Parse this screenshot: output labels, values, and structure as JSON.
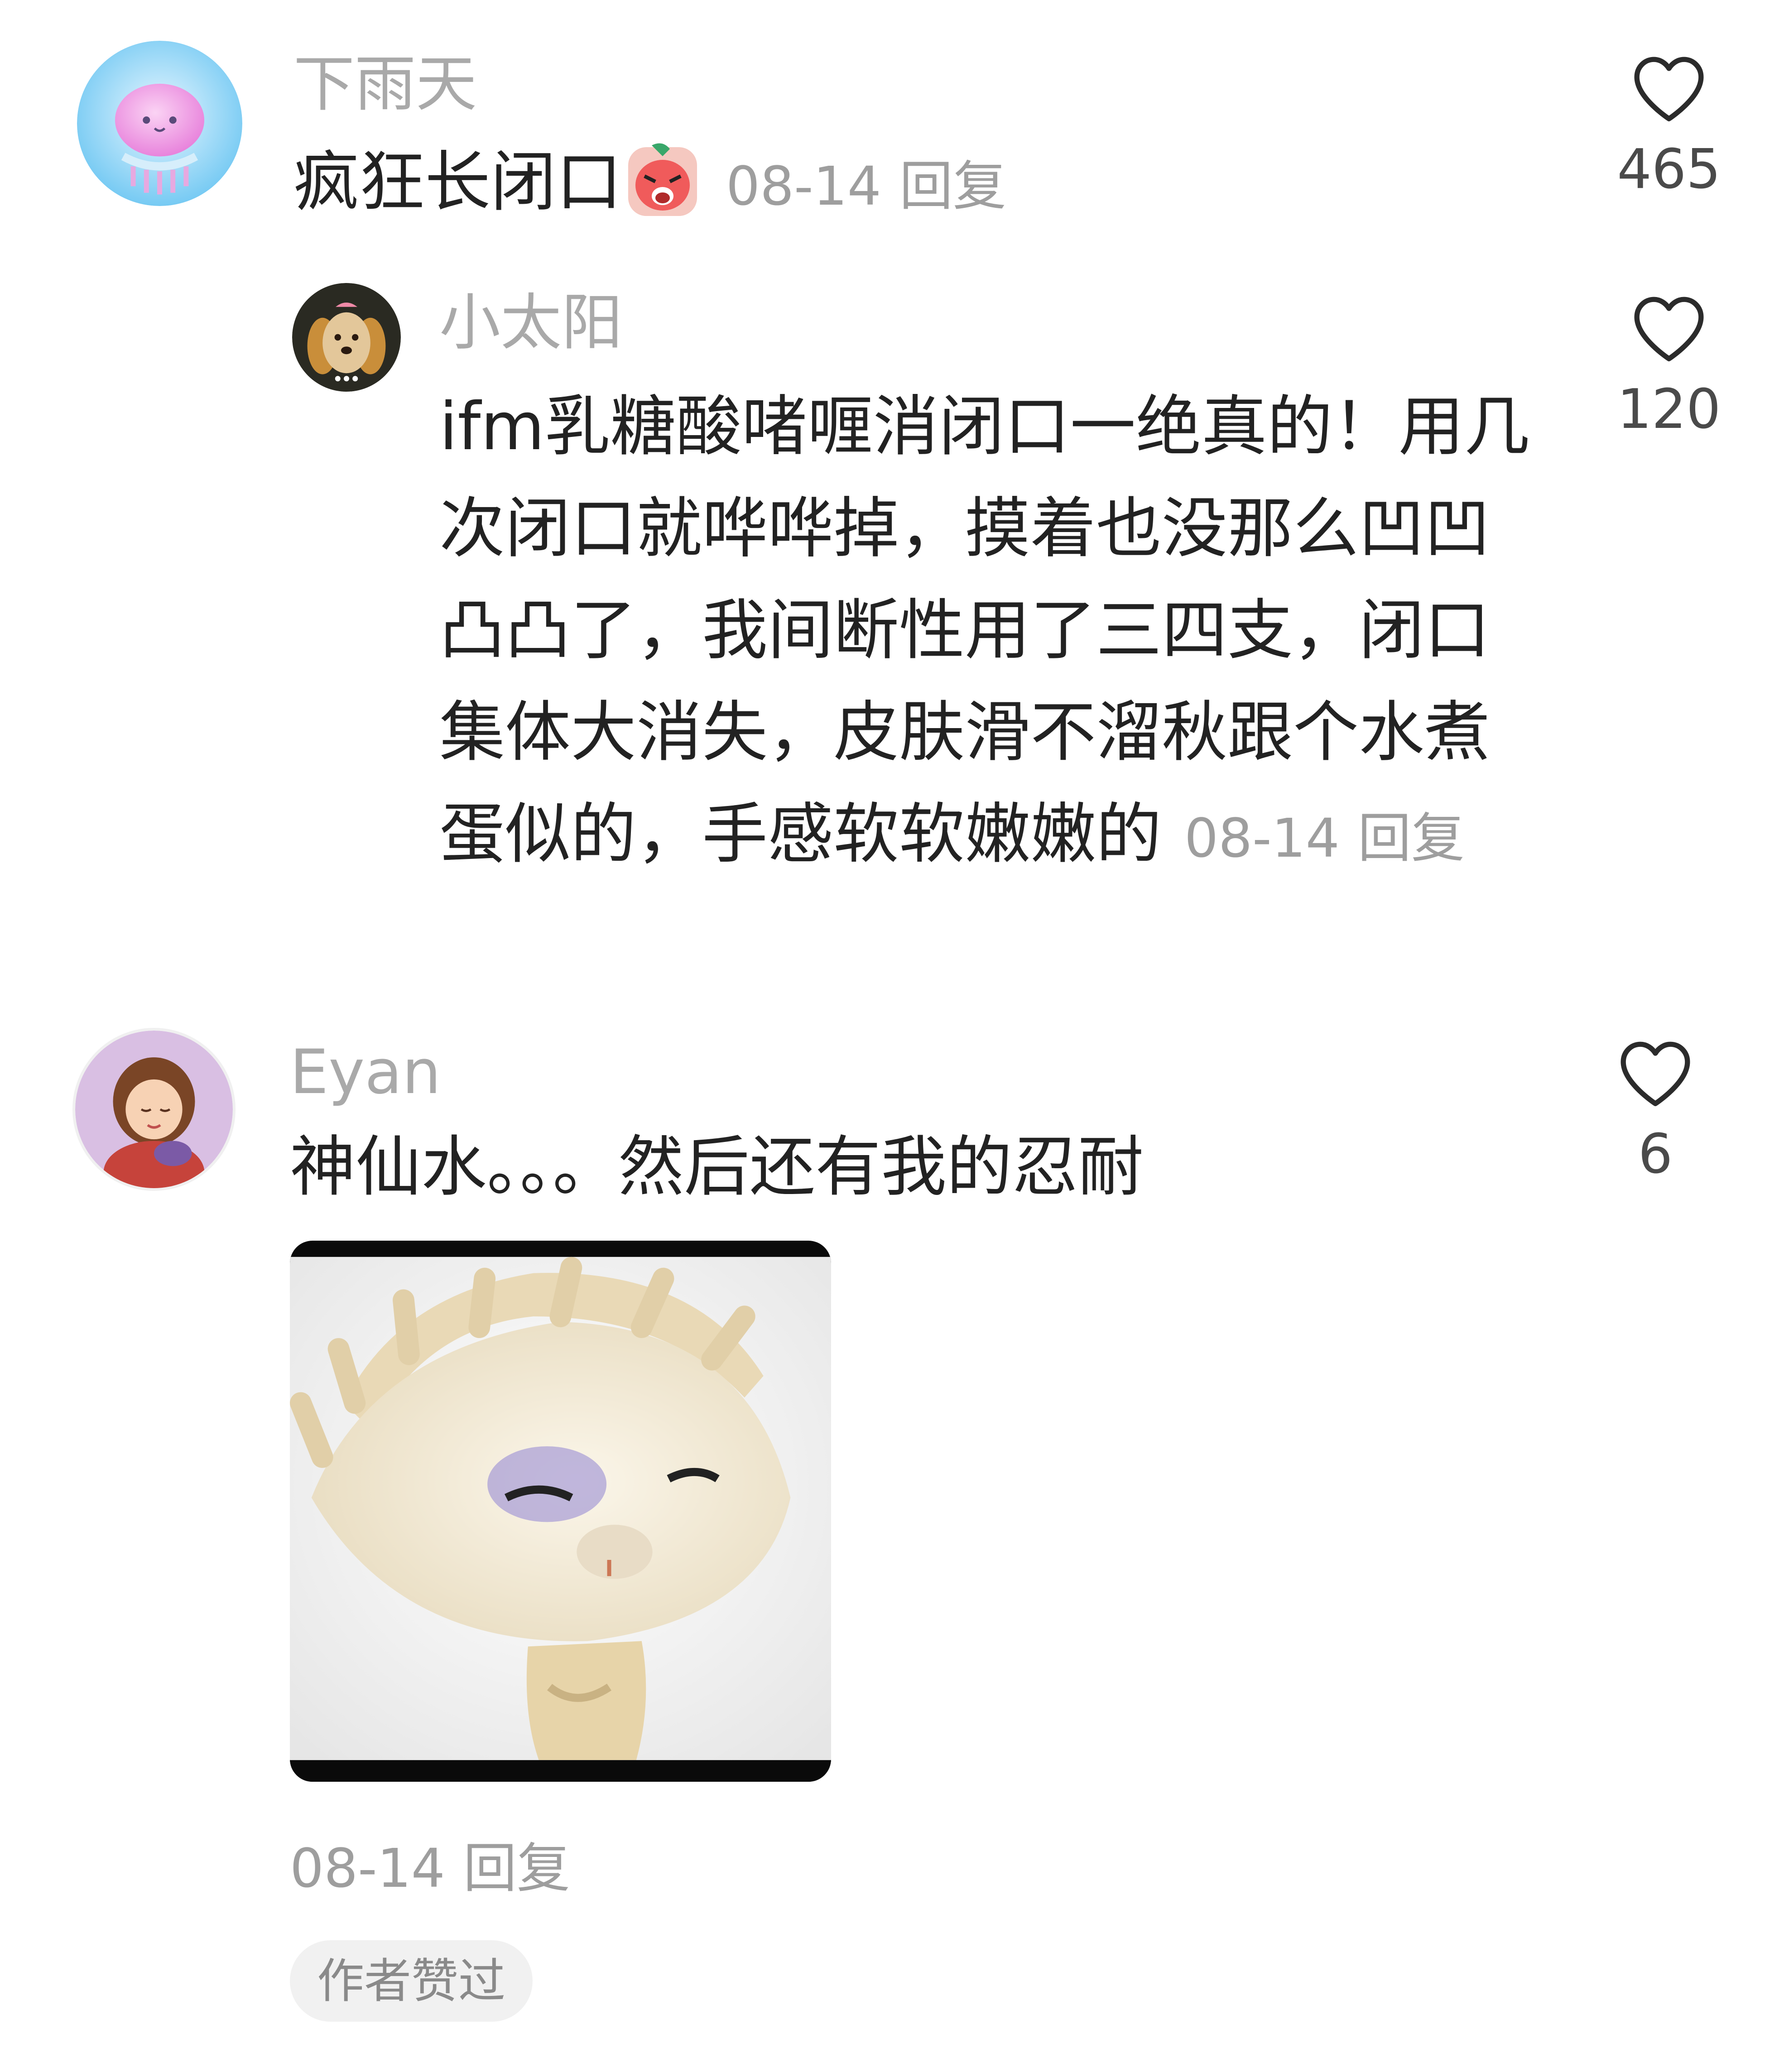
{
  "comments": [
    {
      "username": "下雨天",
      "text": "疯狂长闭口",
      "emoji_icon": "crying-face-sticker-icon",
      "date": "08-14",
      "reply_label": "回复",
      "like_count": "465",
      "avatar_icon": "jellyfish-avatar"
    },
    {
      "username": "Eyan",
      "text": "神仙水。。。然后还有我的忍耐",
      "date": "08-14",
      "reply_label": "回复",
      "like_count": "6",
      "avatar_icon": "girl-cartoon-avatar",
      "attachment_icon": "dumpling-meme-sticker",
      "badge": "作者赞过"
    }
  ],
  "reply": {
    "username": "小太阳",
    "lines": [
      "ifm乳糖酸啫喱消闭口一绝真的！用几",
      "次闭口就哗哗掉，摸着也没那么凹凹",
      "凸凸了，我间断性用了三四支，闭口",
      "集体大消失，皮肤滑不溜秋跟个水煮",
      "蛋似的，手感软软嫩嫩的"
    ],
    "date": "08-14",
    "reply_label": "回复",
    "like_count": "120",
    "avatar_icon": "dog-avatar"
  },
  "colors": {
    "username": "#a9a9a9",
    "text": "#222222",
    "meta": "#9e9e9e",
    "badge_bg": "#f1f1f1"
  }
}
